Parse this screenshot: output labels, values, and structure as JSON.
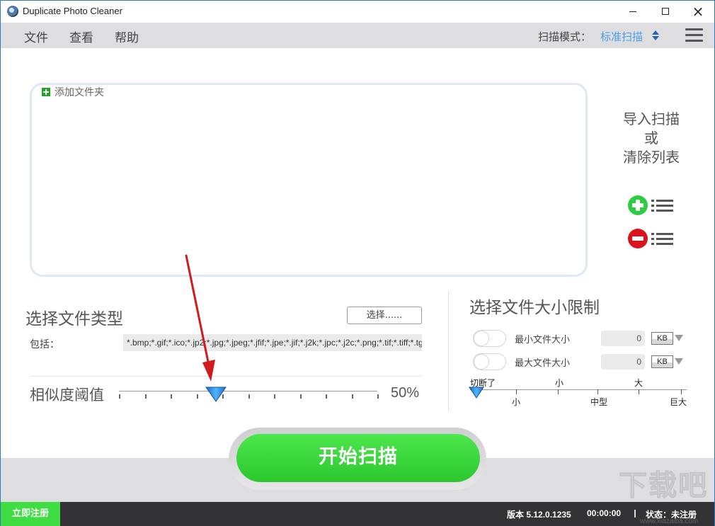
{
  "window": {
    "title": "Duplicate Photo Cleaner",
    "controls": {
      "minimize": "minimize",
      "maximize": "maximize",
      "close": "×"
    }
  },
  "menu": {
    "items": [
      "文件",
      "查看",
      "帮助"
    ],
    "scan_mode_label": "扫描模式：",
    "scan_mode_value": "标准扫描"
  },
  "folder_panel": {
    "add_folder_label": "添加文件夹"
  },
  "side_panel": {
    "line1": "导入扫描",
    "line2": "或",
    "line3": "清除列表",
    "import_icon": "plus-list-icon",
    "clear_icon": "minus-list-icon",
    "colors": {
      "import": "#2ecc40",
      "clear": "#d9121b"
    }
  },
  "file_types": {
    "title": "选择文件类型",
    "choose_button": "选择......",
    "include_label": "包括：",
    "extensions": "*.bmp;*.gif;*.ico;*.jp2;*.jpg;*.jpeg;*.jfif;*.jpe;*.jif;*.j2k;*.jpc;*.j2c;*.png;*.tif;*.tiff;*.tg"
  },
  "similarity": {
    "label": "相似度阈值",
    "value_text": "50%",
    "value_percent": 50,
    "tick_count": 11
  },
  "file_size": {
    "title": "选择文件大小限制",
    "min": {
      "label": "最小文件大小",
      "value": "0",
      "unit": "KB",
      "enabled": false
    },
    "max": {
      "label": "最大文件大小",
      "value": "0",
      "unit": "KB",
      "enabled": false
    },
    "scale_top": [
      "切断了",
      "小",
      "大"
    ],
    "scale_bottom": [
      "小",
      "中型",
      "巨大"
    ],
    "selected_index": 0
  },
  "actions": {
    "start_scan": "开始扫描",
    "register": "立即注册"
  },
  "status": {
    "version": "版本 5.12.0.1235",
    "time": "00:00:00",
    "state": "状态：未注册"
  },
  "watermark": {
    "text": "下载吧",
    "url": "www.xiazaiba.com"
  },
  "colors": {
    "accent_blue": "#4a9ee0",
    "start_green": "#3ede42",
    "statusbar": "#333235",
    "annotation_red": "#d11a1a"
  }
}
